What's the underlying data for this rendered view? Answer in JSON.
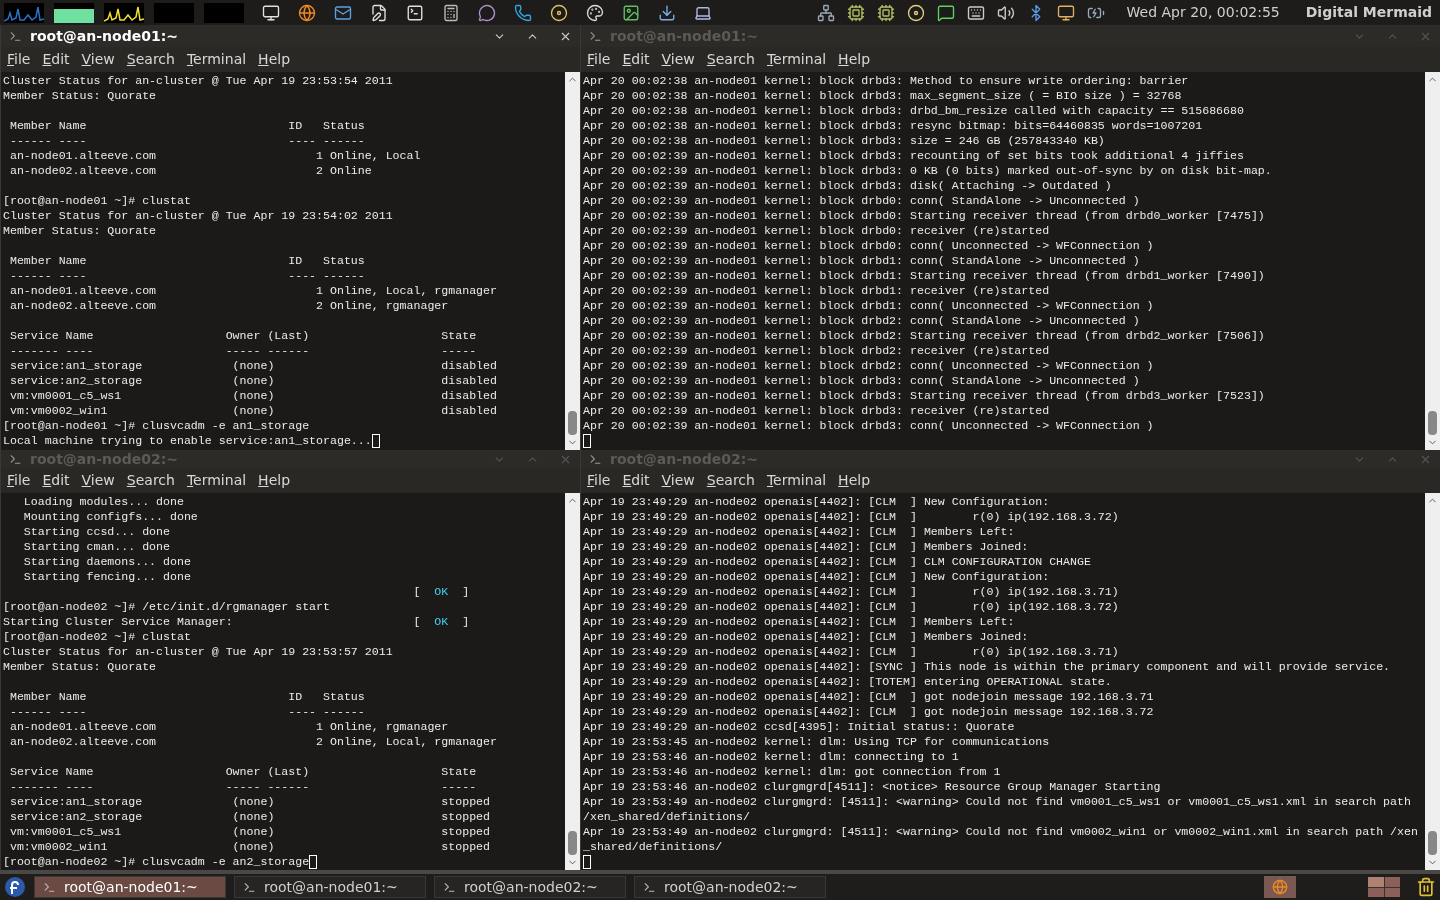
{
  "top_panel": {
    "clock": "Wed Apr 20, 00:02:55",
    "user": "Digital Mermaid"
  },
  "windows": [
    {
      "title": "root@an-node01:~",
      "active": true,
      "menu": [
        "File",
        "Edit",
        "View",
        "Search",
        "Terminal",
        "Help"
      ],
      "cursor_on_new_line": false,
      "lines": [
        "Cluster Status for an-cluster @ Tue Apr 19 23:53:54 2011",
        "Member Status: Quorate",
        {
          "kind": "blank"
        },
        " Member Name                             ID   Status",
        " ------ ----                             ---- ------",
        " an-node01.alteeve.com                       1 Online, Local",
        " an-node02.alteeve.com                       2 Online",
        {
          "kind": "blank"
        },
        "[root@an-node01 ~]# clustat",
        "Cluster Status for an-cluster @ Tue Apr 19 23:54:02 2011",
        "Member Status: Quorate",
        {
          "kind": "blank"
        },
        " Member Name                             ID   Status",
        " ------ ----                             ---- ------",
        " an-node01.alteeve.com                       1 Online, Local, rgmanager",
        " an-node02.alteeve.com                       2 Online, rgmanager",
        {
          "kind": "blank"
        },
        " Service Name                   Owner (Last)                   State",
        " ------- ----                   ----- ------                   -----",
        " service:an1_storage             (none)                        disabled",
        " service:an2_storage             (none)                        disabled",
        " vm:vm0001_c5_ws1                (none)                        disabled",
        " vm:vm0002_win1                  (none)                        disabled",
        "[root@an-node01 ~]# clusvcadm -e an1_storage",
        "Local machine trying to enable service:an1_storage..."
      ]
    },
    {
      "title": "root@an-node01:~",
      "active": false,
      "menu": [
        "File",
        "Edit",
        "View",
        "Search",
        "Terminal",
        "Help"
      ],
      "cursor_on_new_line": true,
      "lines": [
        "Apr 20 00:02:38 an-node01 kernel: block drbd3: Method to ensure write ordering: barrier",
        "Apr 20 00:02:38 an-node01 kernel: block drbd3: max_segment_size ( = BIO size ) = 32768",
        "Apr 20 00:02:38 an-node01 kernel: block drbd3: drbd_bm_resize called with capacity == 515686680",
        "Apr 20 00:02:38 an-node01 kernel: block drbd3: resync bitmap: bits=64460835 words=1007201",
        "Apr 20 00:02:38 an-node01 kernel: block drbd3: size = 246 GB (257843340 KB)",
        "Apr 20 00:02:39 an-node01 kernel: block drbd3: recounting of set bits took additional 4 jiffies",
        "Apr 20 00:02:39 an-node01 kernel: block drbd3: 0 KB (0 bits) marked out-of-sync by on disk bit-map.",
        "Apr 20 00:02:39 an-node01 kernel: block drbd3: disk( Attaching -> Outdated )",
        "Apr 20 00:02:39 an-node01 kernel: block drbd0: conn( StandAlone -> Unconnected )",
        "Apr 20 00:02:39 an-node01 kernel: block drbd0: Starting receiver thread (from drbd0_worker [7475])",
        "Apr 20 00:02:39 an-node01 kernel: block drbd0: receiver (re)started",
        "Apr 20 00:02:39 an-node01 kernel: block drbd0: conn( Unconnected -> WFConnection )",
        "Apr 20 00:02:39 an-node01 kernel: block drbd1: conn( StandAlone -> Unconnected )",
        "Apr 20 00:02:39 an-node01 kernel: block drbd1: Starting receiver thread (from drbd1_worker [7490])",
        "Apr 20 00:02:39 an-node01 kernel: block drbd1: receiver (re)started",
        "Apr 20 00:02:39 an-node01 kernel: block drbd1: conn( Unconnected -> WFConnection )",
        "Apr 20 00:02:39 an-node01 kernel: block drbd2: conn( StandAlone -> Unconnected )",
        "Apr 20 00:02:39 an-node01 kernel: block drbd2: Starting receiver thread (from drbd2_worker [7506])",
        "Apr 20 00:02:39 an-node01 kernel: block drbd2: receiver (re)started",
        "Apr 20 00:02:39 an-node01 kernel: block drbd2: conn( Unconnected -> WFConnection )",
        "Apr 20 00:02:39 an-node01 kernel: block drbd3: conn( StandAlone -> Unconnected )",
        "Apr 20 00:02:39 an-node01 kernel: block drbd3: Starting receiver thread (from drbd3_worker [7523])",
        "Apr 20 00:02:39 an-node01 kernel: block drbd3: receiver (re)started",
        "Apr 20 00:02:39 an-node01 kernel: block drbd3: conn( Unconnected -> WFConnection )"
      ]
    },
    {
      "title": "root@an-node02:~",
      "active": false,
      "menu": [
        "File",
        "Edit",
        "View",
        "Search",
        "Terminal",
        "Help"
      ],
      "cursor_on_new_line": false,
      "lines": [
        "   Loading modules... done",
        "   Mounting configfs... done",
        "   Starting ccsd... done",
        "   Starting cman... done",
        "   Starting daemons... done",
        "   Starting fencing... done",
        {
          "kind": "parts",
          "parts": [
            {
              "text": "                                                           [  "
            },
            {
              "text": "OK",
              "kind": "ok"
            },
            {
              "text": "  ]"
            }
          ]
        },
        "[root@an-node02 ~]# /etc/init.d/rgmanager start",
        {
          "kind": "parts",
          "parts": [
            {
              "text": "Starting Cluster Service Manager:                          [  "
            },
            {
              "text": "OK",
              "kind": "ok"
            },
            {
              "text": "  ]"
            }
          ]
        },
        "[root@an-node02 ~]# clustat",
        "Cluster Status for an-cluster @ Tue Apr 19 23:53:57 2011",
        "Member Status: Quorate",
        {
          "kind": "blank"
        },
        " Member Name                             ID   Status",
        " ------ ----                             ---- ------",
        " an-node01.alteeve.com                       1 Online, rgmanager",
        " an-node02.alteeve.com                       2 Online, Local, rgmanager",
        {
          "kind": "blank"
        },
        " Service Name                   Owner (Last)                   State",
        " ------- ----                   ----- ------                   -----",
        " service:an1_storage             (none)                        stopped",
        " service:an2_storage             (none)                        stopped",
        " vm:vm0001_c5_ws1                (none)                        stopped",
        " vm:vm0002_win1                  (none)                        stopped",
        "[root@an-node02 ~]# clusvcadm -e an2_storage"
      ]
    },
    {
      "title": "root@an-node02:~",
      "active": false,
      "menu": [
        "File",
        "Edit",
        "View",
        "Search",
        "Terminal",
        "Help"
      ],
      "cursor_on_new_line": true,
      "lines": [
        "Apr 19 23:49:29 an-node02 openais[4402]: [CLM  ] New Configuration:",
        "Apr 19 23:49:29 an-node02 openais[4402]: [CLM  ]        r(0) ip(192.168.3.72)",
        "Apr 19 23:49:29 an-node02 openais[4402]: [CLM  ] Members Left:",
        "Apr 19 23:49:29 an-node02 openais[4402]: [CLM  ] Members Joined:",
        "Apr 19 23:49:29 an-node02 openais[4402]: [CLM  ] CLM CONFIGURATION CHANGE",
        "Apr 19 23:49:29 an-node02 openais[4402]: [CLM  ] New Configuration:",
        "Apr 19 23:49:29 an-node02 openais[4402]: [CLM  ]        r(0) ip(192.168.3.71)",
        "Apr 19 23:49:29 an-node02 openais[4402]: [CLM  ]        r(0) ip(192.168.3.72)",
        "Apr 19 23:49:29 an-node02 openais[4402]: [CLM  ] Members Left:",
        "Apr 19 23:49:29 an-node02 openais[4402]: [CLM  ] Members Joined:",
        "Apr 19 23:49:29 an-node02 openais[4402]: [CLM  ]        r(0) ip(192.168.3.71)",
        "Apr 19 23:49:29 an-node02 openais[4402]: [SYNC ] This node is within the primary component and will provide service.",
        "Apr 19 23:49:29 an-node02 openais[4402]: [TOTEM] entering OPERATIONAL state.",
        "Apr 19 23:49:29 an-node02 openais[4402]: [CLM  ] got nodejoin message 192.168.3.71",
        "Apr 19 23:49:29 an-node02 openais[4402]: [CLM  ] got nodejoin message 192.168.3.72",
        "Apr 19 23:49:29 an-node02 ccsd[4395]: Initial status:: Quorate",
        "Apr 19 23:53:45 an-node02 kernel: dlm: Using TCP for communications",
        "Apr 19 23:53:46 an-node02 kernel: dlm: connecting to 1",
        "Apr 19 23:53:46 an-node02 kernel: dlm: got connection from 1",
        "Apr 19 23:53:46 an-node02 clurgmgrd[4511]: <notice> Resource Group Manager Starting",
        "Apr 19 23:53:49 an-node02 clurgmgrd: [4511]: <warning> Could not find vm0001_c5_ws1 or vm0001_c5_ws1.xml in search path",
        "/xen_shared/definitions/",
        "Apr 19 23:53:49 an-node02 clurgmgrd: [4511]: <warning> Could not find vm0002_win1 or vm0002_win1.xml in search path /xen",
        "_shared/definitions/"
      ]
    }
  ],
  "taskbar": {
    "tasks": [
      {
        "label": "root@an-node01:~",
        "selected": true
      },
      {
        "label": "root@an-node01:~",
        "selected": false
      },
      {
        "label": "root@an-node02:~",
        "selected": false
      },
      {
        "label": "root@an-node02:~",
        "selected": false
      }
    ]
  }
}
